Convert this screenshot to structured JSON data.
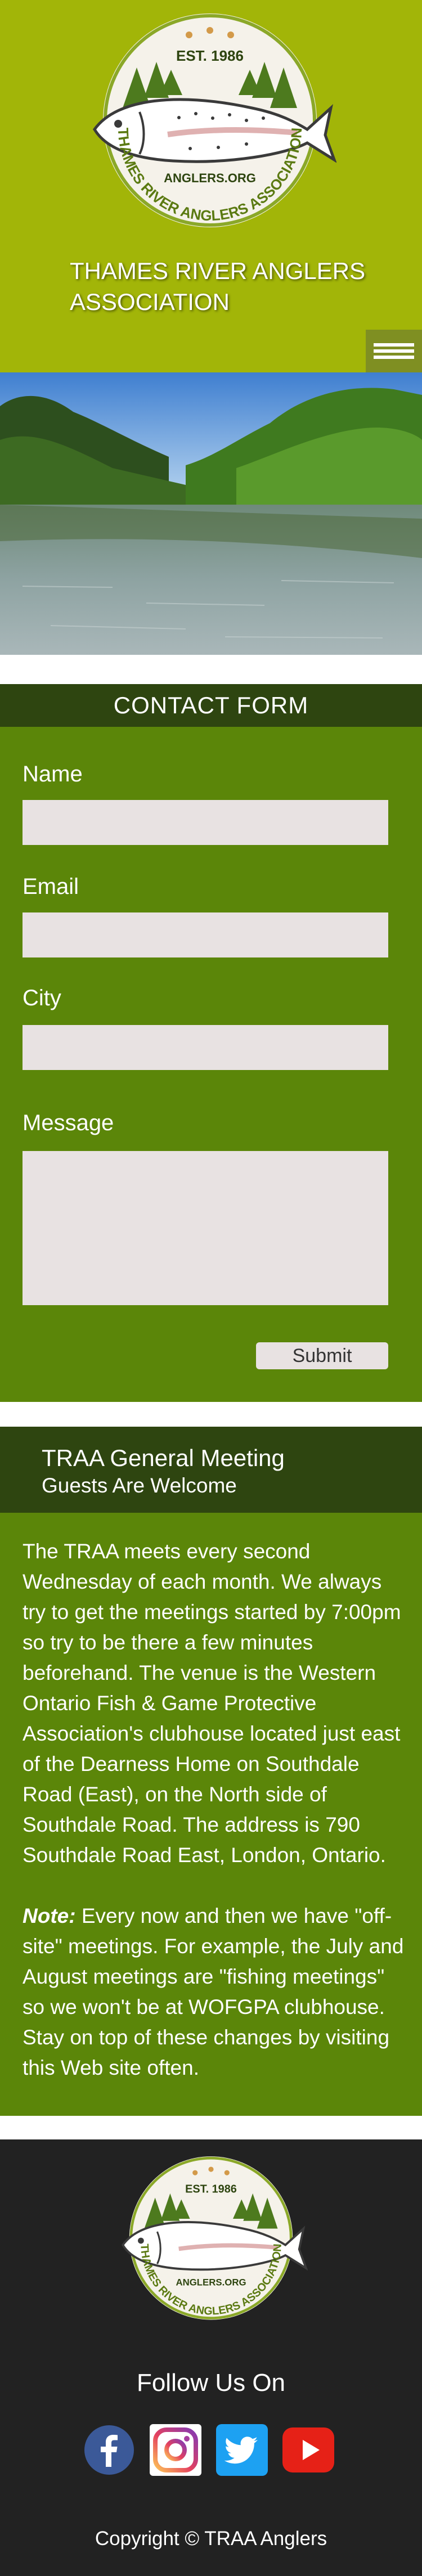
{
  "header": {
    "site_title": "THAMES RIVER ANGLERS ASSOCIATION",
    "logo": {
      "est_text": "EST. 1986",
      "domain_text": "ANGLERS.ORG",
      "ring_text": "THAMES RIVER ANGLERS ASSOCIATION"
    },
    "menu_icon": "hamburger-icon"
  },
  "hero": {
    "image": "river-scene"
  },
  "contact_form": {
    "heading": "CONTACT FORM",
    "fields": {
      "name_label": "Name",
      "email_label": "Email",
      "city_label": "City",
      "message_label": "Message"
    },
    "submit_label": "Submit"
  },
  "meeting": {
    "title": "TRAA General Meeting",
    "subtitle": "Guests Are Welcome",
    "paragraph1": "The TRAA meets every second Wednesday of each month. We always try to get the meetings started by 7:00pm so try to be there a few minutes beforehand. The venue is the Western Ontario Fish & Game Protective Association's clubhouse located just east of the Dearness Home on Southdale Road (East), on the North side of Southdale Road. The address is 790 Southdale Road East, London, Ontario.",
    "note_label": "Note:",
    "note_text": " Every now and then we have \"off-site\" meetings. For example, the July and August meetings are \"fishing meetings\" so we won't be at WOFGPA clubhouse. Stay on top of these changes by visiting this Web site often."
  },
  "footer": {
    "follow_text": "Follow Us On",
    "social": [
      {
        "name": "facebook",
        "icon": "facebook-icon",
        "color": "#3b5998"
      },
      {
        "name": "instagram",
        "icon": "instagram-icon",
        "color": "#c13584"
      },
      {
        "name": "twitter",
        "icon": "twitter-icon",
        "color": "#1da1f2"
      },
      {
        "name": "youtube",
        "icon": "youtube-icon",
        "color": "#e62117"
      }
    ],
    "copyright": "Copyright © TRAA Anglers"
  },
  "colors": {
    "header_bg": "#a2b508",
    "section_dark": "#2e4510",
    "section_green": "#5b8609",
    "footer_bg": "#222222",
    "field_bg": "#e8e2e2"
  }
}
